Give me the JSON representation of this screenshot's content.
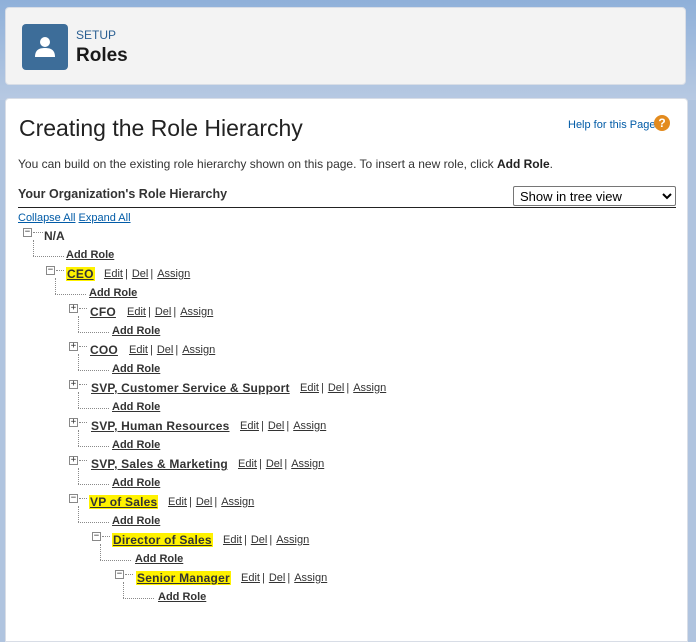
{
  "header": {
    "eyebrow": "SETUP",
    "title": "Roles",
    "icon": "user-icon",
    "icon_color": "#3d6d99"
  },
  "page": {
    "title": "Creating the Role Hierarchy",
    "help_link": "Help for this Page",
    "help_icon": "?",
    "intro_text": "You can build on the existing role hierarchy shown on this page. To insert a new role, click ",
    "intro_bold": "Add Role",
    "intro_end": "."
  },
  "hierarchy": {
    "section_title": "Your Organization's Role Hierarchy",
    "view_options": [
      "Show in tree view"
    ],
    "view_selected": "Show in tree view",
    "collapse_all": "Collapse All",
    "expand_all": "Expand All",
    "root": "N/A",
    "add_role": "Add Role",
    "edit": "Edit",
    "del": "Del",
    "assign": "Assign",
    "separator": "|",
    "collapsed_glyph": "+",
    "expanded_glyph": "−",
    "highlight_color": "#fff200",
    "roles": {
      "ceo": "CEO",
      "cfo": "CFO",
      "coo": "COO",
      "svp_cs": "SVP, Customer Service & Support",
      "svp_hr": "SVP, Human Resources",
      "svp_sm": "SVP, Sales & Marketing",
      "vp_sales": "VP of Sales",
      "dir_sales": "Director of Sales",
      "senior_mgr": "Senior Manager"
    }
  }
}
